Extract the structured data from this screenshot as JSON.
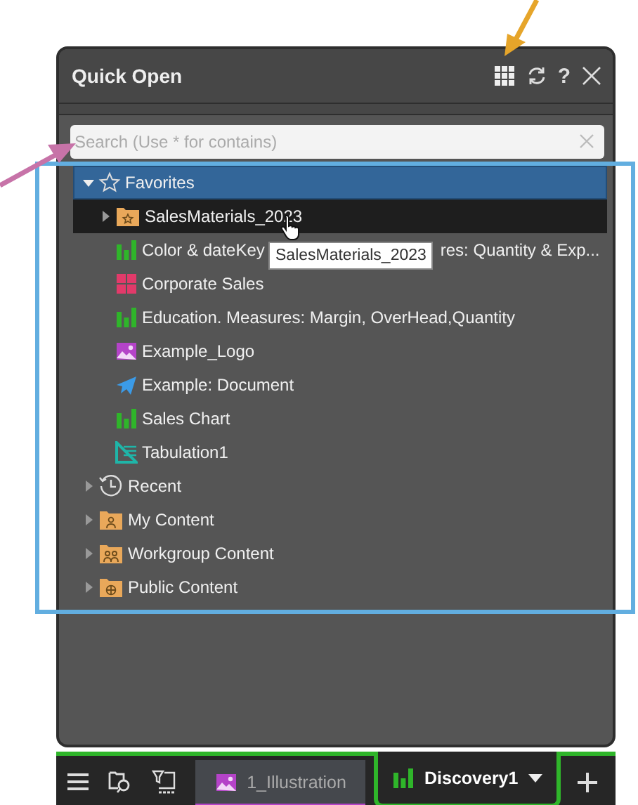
{
  "panel": {
    "title": "Quick Open",
    "help_label": "?"
  },
  "search": {
    "placeholder": "Search (Use * for contains)"
  },
  "tree": [
    {
      "label": "Favorites",
      "kind": "favorites",
      "expanded": true,
      "selected": true,
      "hovered": false,
      "children": [
        {
          "label": "SalesMaterials_2023",
          "kind": "star-folder",
          "expanded": false,
          "selected": false,
          "hovered": true
        },
        {
          "label": "Color & dateKey",
          "label_after_tooltip": "res: Quantity & Exp...",
          "kind": "chart",
          "selected": false,
          "hovered": false
        },
        {
          "label": "Corporate Sales",
          "kind": "dashboard",
          "selected": false,
          "hovered": false
        },
        {
          "label": "Education. Measures: Margin, OverHead,Quantity",
          "kind": "chart",
          "selected": false,
          "hovered": false
        },
        {
          "label": "Example_Logo",
          "kind": "image",
          "selected": false,
          "hovered": false
        },
        {
          "label": "Example: Document",
          "kind": "document",
          "selected": false,
          "hovered": false
        },
        {
          "label": "Sales Chart",
          "kind": "chart",
          "selected": false,
          "hovered": false
        },
        {
          "label": "Tabulation1",
          "kind": "tabulation",
          "selected": false,
          "hovered": false
        }
      ]
    },
    {
      "label": "Recent",
      "kind": "recent",
      "expanded": false,
      "selected": false,
      "hovered": false
    },
    {
      "label": "My Content",
      "kind": "user-folder",
      "expanded": false,
      "selected": false,
      "hovered": false
    },
    {
      "label": "Workgroup Content",
      "kind": "group-folder",
      "expanded": false,
      "selected": false,
      "hovered": false
    },
    {
      "label": "Public Content",
      "kind": "globe-folder",
      "expanded": false,
      "selected": false,
      "hovered": false
    }
  ],
  "tooltip": {
    "text": "SalesMaterials_2023"
  },
  "tabs": [
    {
      "label": "1_Illustration",
      "kind": "image",
      "selected": false
    },
    {
      "label": "Discovery1",
      "kind": "chart",
      "selected": true
    }
  ]
}
